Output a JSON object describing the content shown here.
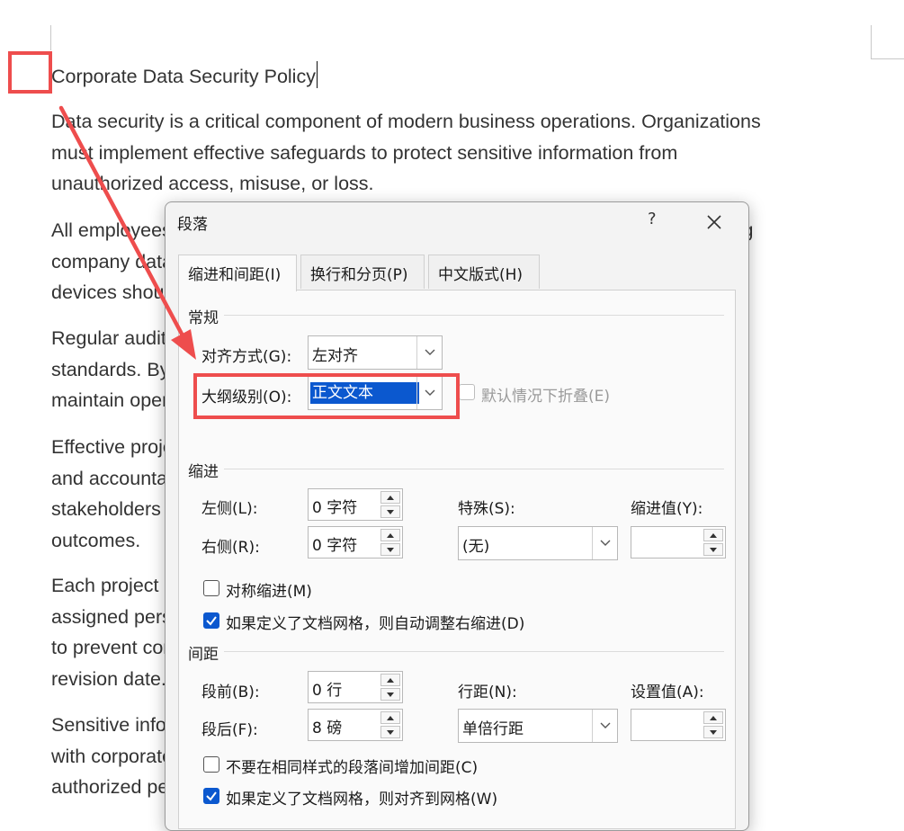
{
  "document": {
    "title": "Corporate Data Security Policy",
    "paragraphs": [
      [
        "Data security is a critical component of modern business operations. Organizations",
        "must implement effective safeguards to protect sensitive information from",
        "unauthorized access, misuse, or loss."
      ],
      [
        "All employees are responsible for following established procedures when handling",
        "company data. Confidential files must be stored only in approved storage",
        "devices should be encrypted."
      ],
      [
        "Regular audits are conducted to ensure compliance with internal",
        "standards. By identifying vulnerabilities early, the company can build trust and",
        "maintain operational resilience."
      ],
      [
        "Effective project management is essential for maintaining consistency,",
        "and accountability. Managers should ensure that all",
        "stakeholders understand the project scope, timelines, and expected",
        "outcomes."
      ],
      [
        "Each project should clearly define roles and task descriptions,",
        "assigned personnel, and controls that must be implemented",
        "to prevent conflicts. Documents must be recorded with a",
        "revision date."
      ],
      [
        "Sensitive information must be handled in strict compliance",
        "with corporate policies. Access should be restricted to",
        "authorized personnel only, ensuring that the",
        ""
      ]
    ]
  },
  "dialog": {
    "title": "段落",
    "help": "?",
    "close": "✕",
    "tabs": [
      {
        "label": "缩进和间距(I)",
        "active": true
      },
      {
        "label": "换行和分页(P)",
        "active": false
      },
      {
        "label": "中文版式(H)",
        "active": false
      }
    ],
    "general": {
      "section": "常规",
      "alignment_label": "对齐方式(G):",
      "alignment_value": "左对齐",
      "outline_label": "大纲级别(O):",
      "outline_value": "正文文本",
      "collapse_label": "默认情况下折叠(E)",
      "collapse_checked": false
    },
    "indent": {
      "section": "缩进",
      "left_label": "左侧(L):",
      "left_value": "0 字符",
      "right_label": "右侧(R):",
      "right_value": "0 字符",
      "special_label": "特殊(S):",
      "special_value": "(无)",
      "by_label": "缩进值(Y):",
      "by_value": "",
      "mirror_label": "对称缩进(M)",
      "mirror_checked": false,
      "auto_right_label": "如果定义了文档网格，则自动调整右缩进(D)",
      "auto_right_checked": true
    },
    "spacing": {
      "section": "间距",
      "before_label": "段前(B):",
      "before_value": "0 行",
      "after_label": "段后(F):",
      "after_value": "8 磅",
      "line_label": "行距(N):",
      "line_value": "单倍行距",
      "at_label": "设置值(A):",
      "at_value": "",
      "no_space_label": "不要在相同样式的段落间增加间距(C)",
      "no_space_checked": false,
      "snap_grid_label": "如果定义了文档网格，则对齐到网格(W)",
      "snap_grid_checked": true
    }
  },
  "colors": {
    "annotation": "#ee4d4d",
    "selection": "#0b58cf",
    "checkbox_on": "#0b58cf"
  }
}
